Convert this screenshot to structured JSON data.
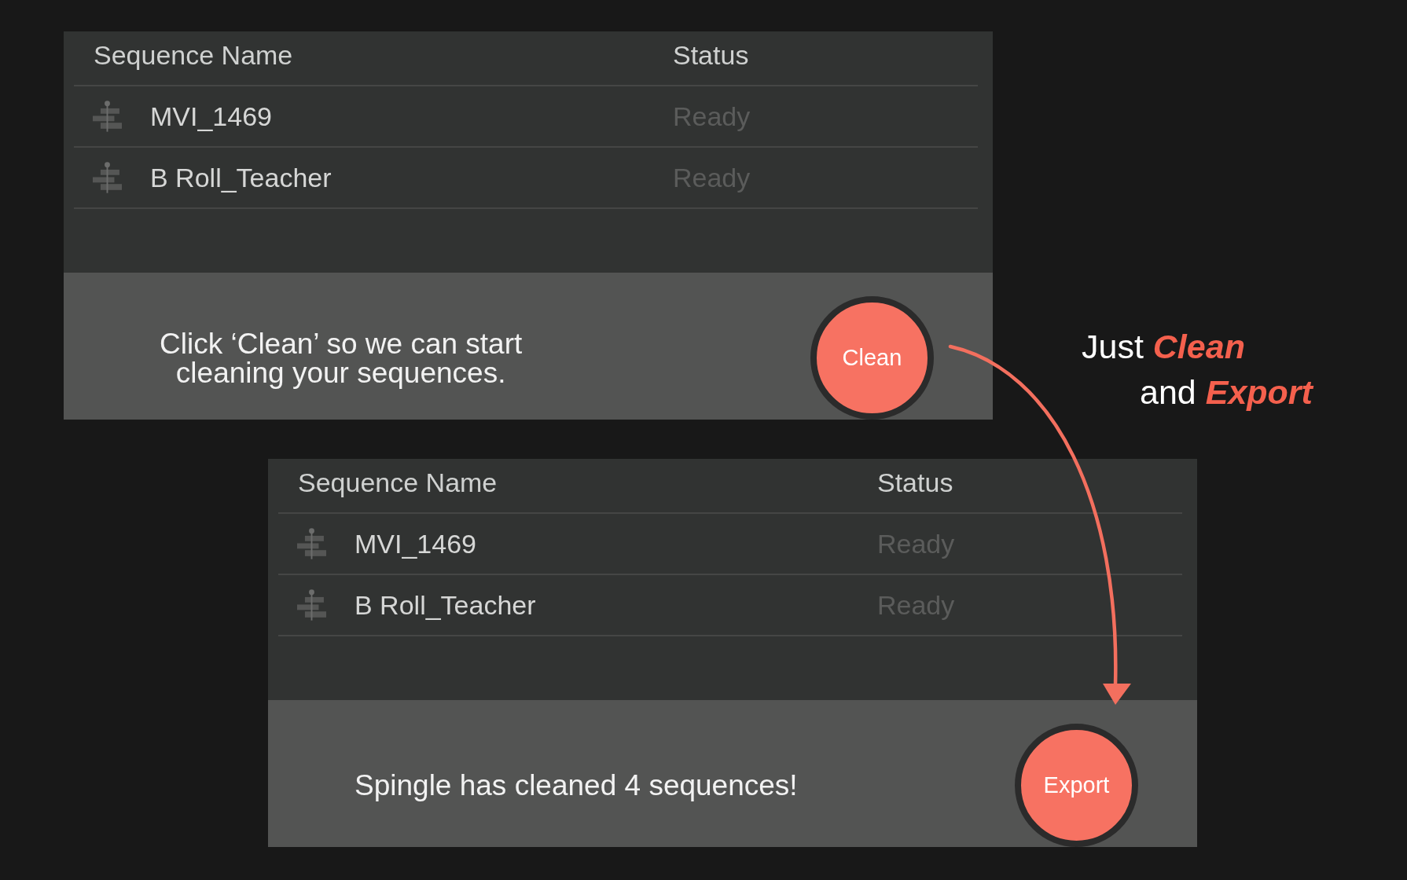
{
  "panels": [
    {
      "table": {
        "columns": [
          "Sequence Name",
          "Status"
        ],
        "rows": [
          {
            "name": "MVI_1469",
            "status": "Ready"
          },
          {
            "name": "B Roll_Teacher",
            "status": "Ready"
          }
        ]
      },
      "footer": {
        "message_lines": [
          "Click ‘Clean’ so we can start",
          "cleaning your sequences."
        ],
        "button": "Clean"
      }
    },
    {
      "table": {
        "columns": [
          "Sequence Name",
          "Status"
        ],
        "rows": [
          {
            "name": "MVI_1469",
            "status": "Ready"
          },
          {
            "name": "B Roll_Teacher",
            "status": "Ready"
          }
        ]
      },
      "footer": {
        "message_lines": [
          "Spingle has cleaned 4 sequences!"
        ],
        "button": "Export"
      }
    }
  ],
  "tagline": {
    "lines": [
      "Just **Clean**",
      "and **Export**"
    ]
  }
}
